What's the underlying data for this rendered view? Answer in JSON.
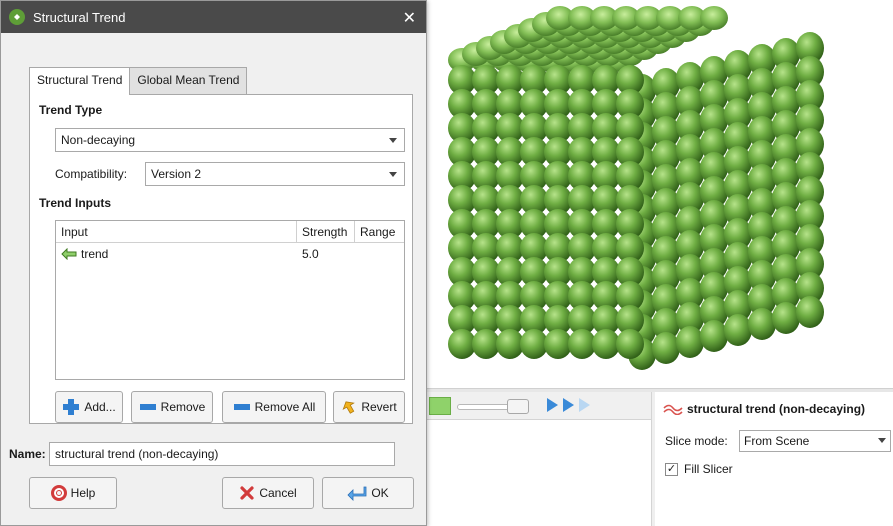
{
  "dialog": {
    "title": "Structural Trend",
    "close_symbol": "✕",
    "tabs": [
      {
        "label": "Structural Trend",
        "active": true
      },
      {
        "label": "Global Mean Trend",
        "active": false
      }
    ],
    "trend_type": {
      "heading": "Trend Type",
      "selected": "Non-decaying",
      "compatibility_label": "Compatibility:",
      "compatibility_value": "Version 2"
    },
    "trend_inputs": {
      "heading": "Trend Inputs",
      "columns": [
        "Input",
        "Strength",
        "Range"
      ],
      "rows": [
        {
          "input": "trend",
          "strength": "5.0",
          "range": "",
          "icon": "trend-arrow-icon"
        }
      ]
    },
    "buttons": {
      "add": "Add...",
      "remove": "Remove",
      "remove_all": "Remove All",
      "revert": "Revert",
      "help": "Help",
      "cancel": "Cancel",
      "ok": "OK"
    },
    "name": {
      "label": "Name:",
      "value": "structural trend (non-decaying)"
    }
  },
  "properties_panel": {
    "title": "structural trend (non-decaying)",
    "slice_mode_label": "Slice mode:",
    "slice_mode_value": "From Scene",
    "fill_slicer_label": "Fill Slicer",
    "fill_slicer_checked": true,
    "check_mark": "✓"
  },
  "colors": {
    "titlebar": "#4a4a4a",
    "sphere_green": "#6aa83e",
    "accent_blue": "#3a8ad8"
  }
}
